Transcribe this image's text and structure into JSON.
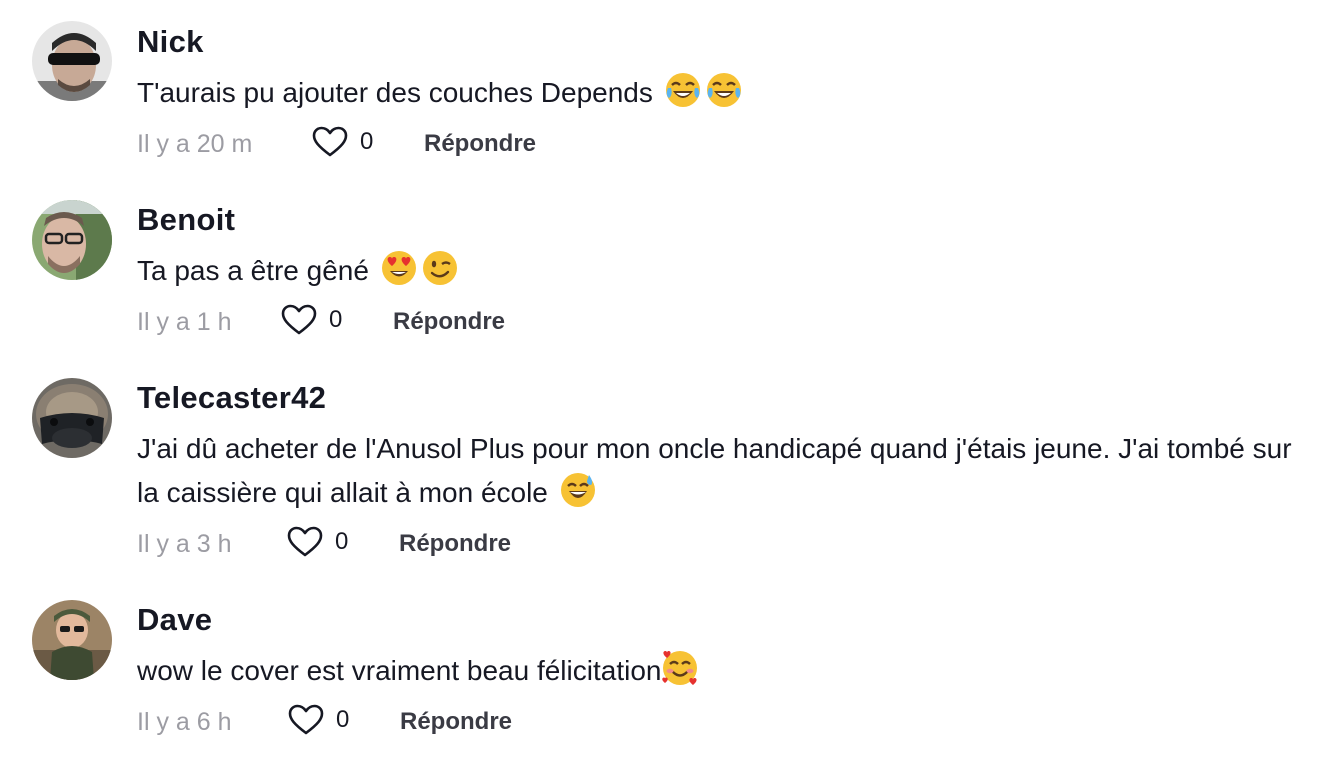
{
  "comments": [
    {
      "username": "Nick",
      "text": "T'aurais pu ajouter des couches Depends",
      "emojis": [
        "joy-emoji",
        "joy-emoji"
      ],
      "time": "Il y a 20 m",
      "likes": "0",
      "reply_label": "Répondre"
    },
    {
      "username": "Benoit",
      "text": "Ta pas a être gêné",
      "emojis": [
        "heart-eyes-emoji",
        "wink-emoji"
      ],
      "time": "Il y a 1 h",
      "likes": "0",
      "reply_label": "Répondre"
    },
    {
      "username": "Telecaster42",
      "text": "J'ai dû acheter de l'Anusol Plus pour mon oncle handicapé quand j'étais jeune. J'ai tombé sur la caissière qui allait à mon école",
      "emojis": [
        "sweat-smile-emoji"
      ],
      "time": "Il y a 3 h",
      "likes": "0",
      "reply_label": "Répondre"
    },
    {
      "username": "Dave",
      "text": "wow le cover est vraiment beau félicitation",
      "emojis": [
        "smiling-hearts-emoji"
      ],
      "time": "Il y a 6 h",
      "likes": "0",
      "reply_label": "Répondre"
    }
  ],
  "colors": {
    "text": "#161823",
    "muted": "#9c9ca3",
    "reply": "#3a3b44",
    "emoji_yellow": "#f7c234"
  }
}
